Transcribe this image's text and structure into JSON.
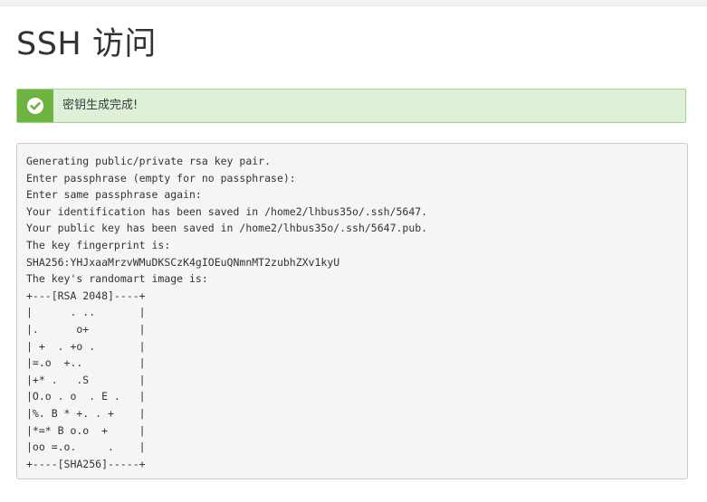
{
  "page": {
    "title": "SSH 访问"
  },
  "alert": {
    "type": "success",
    "icon": "check-circle-icon",
    "message": "密钥生成完成!",
    "colors": {
      "background": "#dff0d8",
      "border": "#a3d48b",
      "icon_background": "#6cb33f"
    }
  },
  "output": {
    "lines": [
      "Generating public/private rsa key pair.",
      "Enter passphrase (empty for no passphrase):",
      "Enter same passphrase again:",
      "Your identification has been saved in /home2/lhbus35o/.ssh/5647.",
      "Your public key has been saved in /home2/lhbus35o/.ssh/5647.pub.",
      "The key fingerprint is:",
      "SHA256:YHJxaaMrzvWMuDKSCzK4gIOEuQNmnMT2zubhZXv1kyU",
      "The key's randomart image is:",
      "+---[RSA 2048]----+",
      "|      . ..       |",
      "|.      o+        |",
      "| +  . +o .       |",
      "|=.o  +..         |",
      "|+* .   .S        |",
      "|O.o . o  . E .   |",
      "|%. B * +. . +    |",
      "|*=* B o.o  +     |",
      "|oo =.o.     .    |",
      "+----[SHA256]-----+"
    ]
  }
}
